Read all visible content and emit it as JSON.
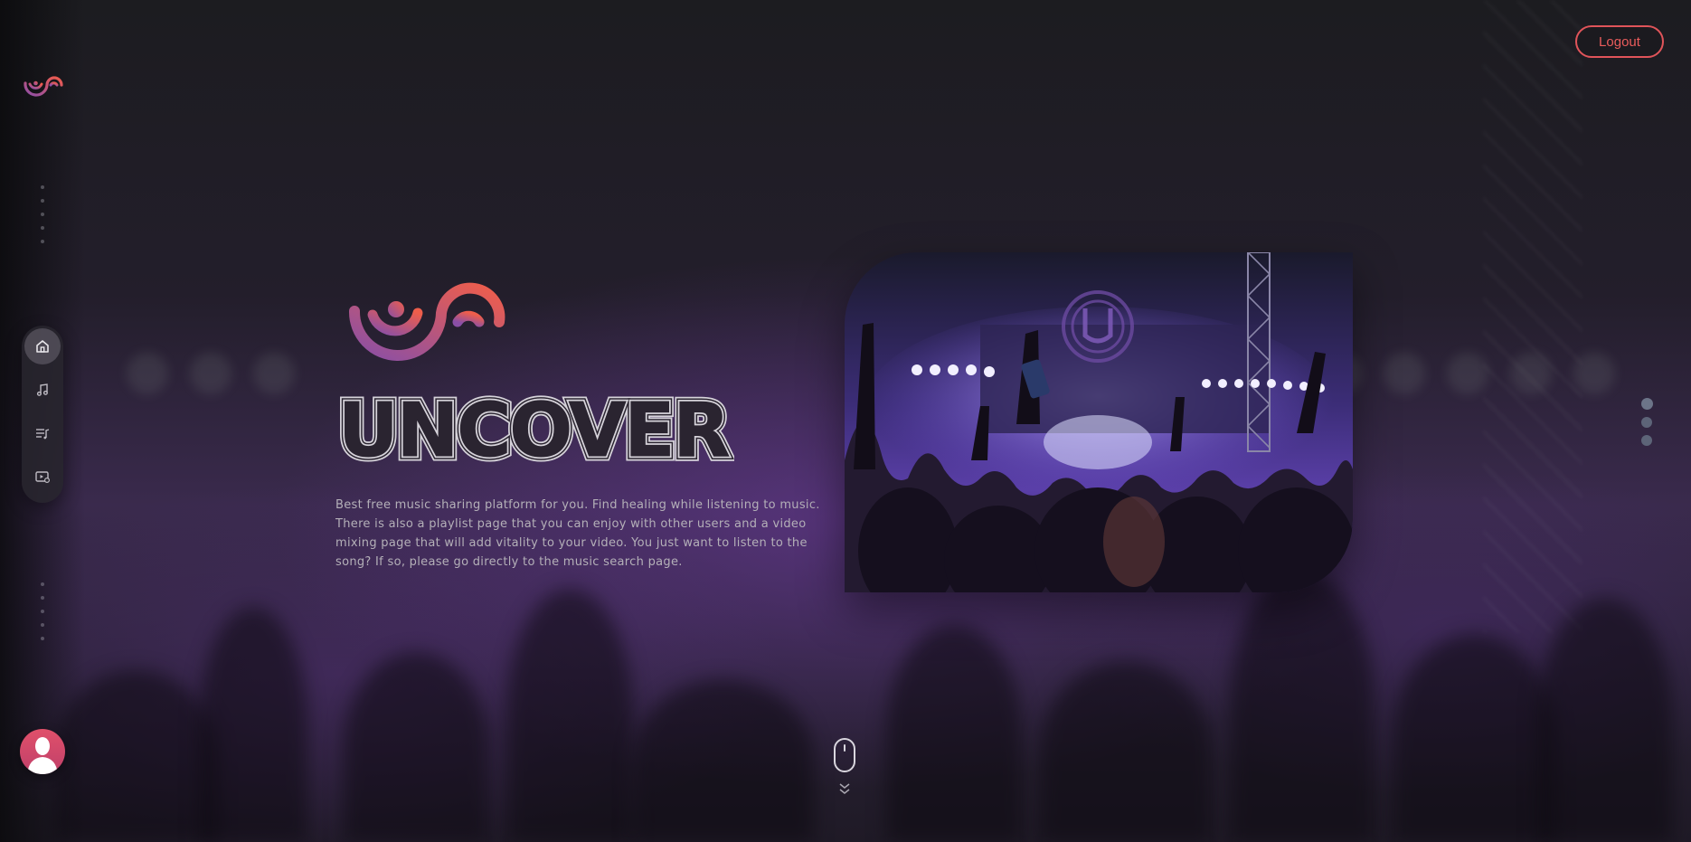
{
  "header": {
    "logout_label": "Logout"
  },
  "hero": {
    "title": "UNCOVER",
    "description": "Best free music sharing platform for you. Find healing while listening to music. There is also a playlist page that you can enjoy with other users and a video mixing page that will add vitality to your video. You just want to listen to the song? If so, please go directly to the music search page."
  },
  "sidebar": {
    "items": [
      {
        "icon": "home-icon",
        "active": true
      },
      {
        "icon": "music-note-icon",
        "active": false
      },
      {
        "icon": "playlist-icon",
        "active": false
      },
      {
        "icon": "video-mix-icon",
        "active": false
      }
    ]
  },
  "pagination": {
    "pages": 3,
    "active_index": 0
  },
  "colors": {
    "accent_red": "#e0545a",
    "logo_gradient_start": "#8e4fa8",
    "logo_gradient_end": "#ef5b4c",
    "sidebar_pill": "#28262e",
    "page_dot": "#5d6478"
  },
  "icons": {
    "brand": "uncover-wave-logo",
    "avatar": "user-avatar",
    "scroll": "mouse-scroll-icon",
    "scroll_arrow": "double-chevron-down-icon"
  }
}
